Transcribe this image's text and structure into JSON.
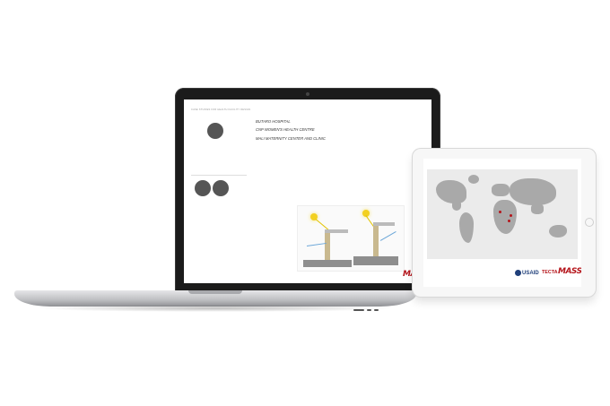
{
  "laptop": {
    "breadcrumb": "CASE STUDIES FOR HEALTH FACILITY DESIGN",
    "sidebar": {
      "circle_1": "",
      "circle_2": "",
      "circle_3": "",
      "nav_left": [
        "",
        "",
        "",
        "",
        "",
        "",
        ""
      ],
      "nav_mid": [
        "",
        "",
        "",
        "",
        "",
        "",
        ""
      ],
      "nav_right": [
        "",
        "",
        "",
        "",
        "",
        ""
      ],
      "nav_lower": [
        "",
        "",
        "",
        "",
        "",
        ""
      ]
    },
    "projects": [
      {
        "title": "BUTARO HOSPITAL",
        "meta": [
          "",
          "",
          "",
          ""
        ]
      },
      {
        "title": "CNP WOMEN'S HEALTH CENTRE",
        "meta": [
          "",
          "",
          "",
          ""
        ]
      },
      {
        "title": "MALI MATERNITY CENTER AND CLINIC",
        "meta": [
          "",
          "",
          "",
          ""
        ]
      }
    ],
    "body_text_1": "",
    "body_text_2": "",
    "logo": "MASS"
  },
  "tablet": {
    "breadcrumb": "",
    "logos": {
      "usaid": "USAID",
      "tecta": "TECTA",
      "mass": "MASS"
    }
  },
  "colors": {
    "brand_red": "#b5151b",
    "map_land": "#a9a9a9",
    "sidebar_circle": "#555555"
  }
}
